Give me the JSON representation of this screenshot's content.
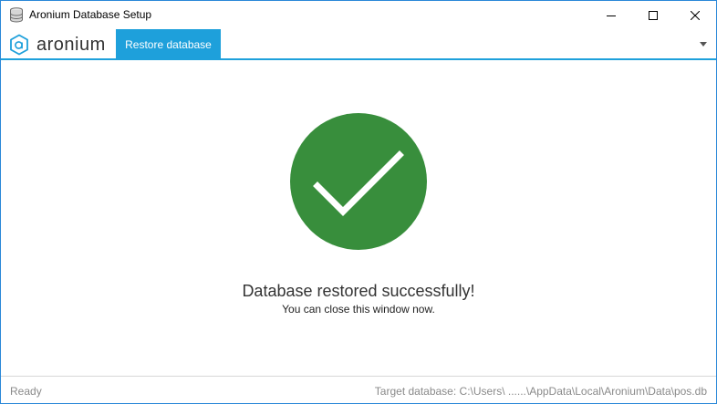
{
  "window": {
    "title": "Aronium Database Setup",
    "controls": [
      "minimize-icon",
      "maximize-icon",
      "close-icon"
    ]
  },
  "header": {
    "logo_text": "aronium",
    "active_tab": "Restore database",
    "accent_color": "#1ea0db"
  },
  "main": {
    "icon": "checkmark-icon",
    "icon_color": "#388e3c",
    "title": "Database restored successfully!",
    "subtitle": "You can close this window now."
  },
  "status": {
    "left": "Ready",
    "right": "Target database: C:\\Users\\ ......\\AppData\\Local\\Aronium\\Data\\pos.db"
  }
}
